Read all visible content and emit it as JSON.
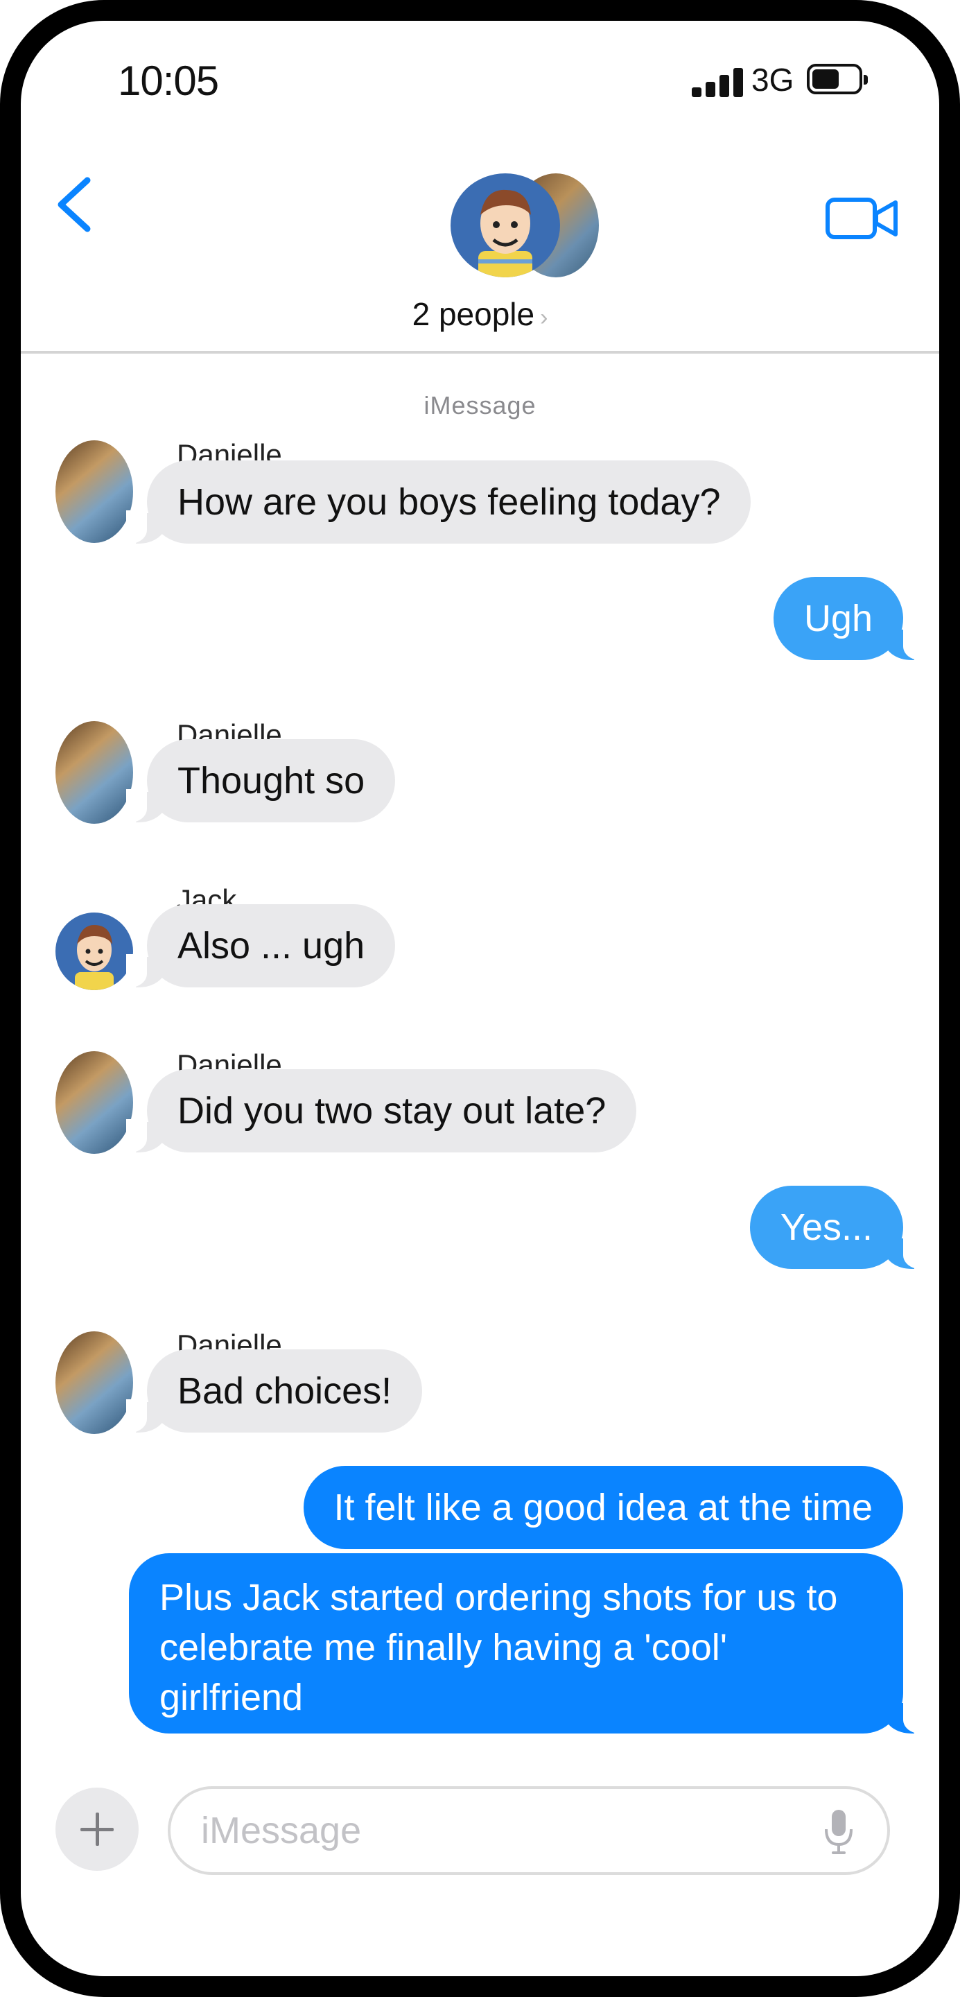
{
  "status": {
    "time": "10:05",
    "network": "3G",
    "icons": [
      "cellular-signal-icon",
      "battery-icon"
    ]
  },
  "header": {
    "back_icon": "chevron-left-icon",
    "group_name": "2 people",
    "group_chevron": "›",
    "video_icon": "video-camera-icon"
  },
  "thread": {
    "service_label": "iMessage",
    "messages": [
      {
        "sender": "Danielle",
        "text": "How are you boys feeling today?",
        "direction": "incoming"
      },
      {
        "sender": "",
        "text": "Ugh",
        "direction": "outgoing"
      },
      {
        "sender": "Danielle",
        "text": "Thought so",
        "direction": "incoming"
      },
      {
        "sender": "Jack",
        "text": "Also ... ugh",
        "direction": "incoming"
      },
      {
        "sender": "Danielle",
        "text": "Did you two stay out late?",
        "direction": "incoming"
      },
      {
        "sender": "",
        "text": "Yes...",
        "direction": "outgoing"
      },
      {
        "sender": "Danielle",
        "text": "Bad choices!",
        "direction": "incoming"
      },
      {
        "sender": "",
        "text": "It felt like a good idea at the time",
        "direction": "outgoing"
      },
      {
        "sender": "",
        "text": "Plus Jack started ordering shots for us to celebrate me finally having a 'cool' girlfriend",
        "direction": "outgoing"
      }
    ]
  },
  "composer": {
    "plus_icon": "plus-icon",
    "placeholder": "iMessage",
    "value": "",
    "mic_icon": "microphone-icon"
  },
  "colors": {
    "incoming_bubble": "#e9e9eb",
    "outgoing_bubble_light": "#3aa3f7",
    "outgoing_bubble": "#0a84ff",
    "accent": "#0a84ff"
  }
}
